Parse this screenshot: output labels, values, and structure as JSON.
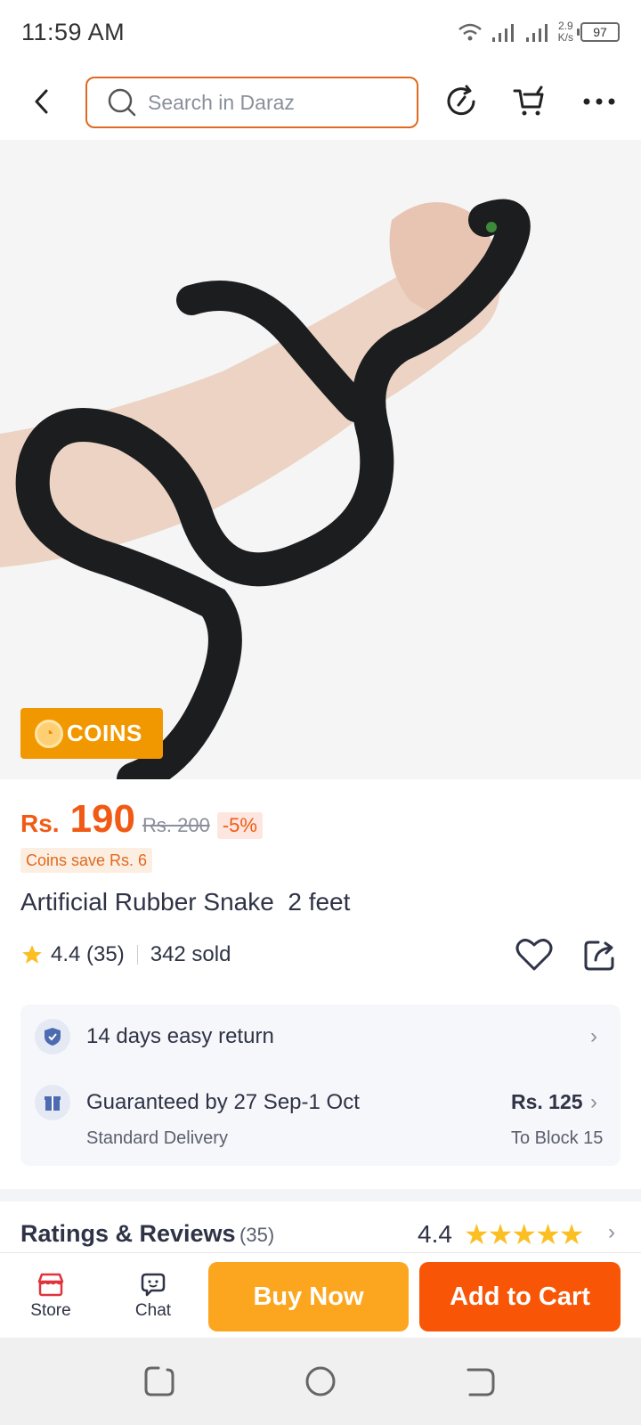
{
  "status_bar": {
    "time": "11:59 AM",
    "speed_value": "2.9",
    "speed_unit": "K/s",
    "battery": "97"
  },
  "header": {
    "search_placeholder": "Search in Daraz"
  },
  "product": {
    "coins_badge": "COINS",
    "currency": "Rs.",
    "price": "190",
    "old_price": "Rs. 200",
    "discount": "-5%",
    "coins_save": "Coins save Rs. 6",
    "title": "Artificial Rubber Snake  2 feet",
    "rating": "4.4 (35)",
    "sold": "342 sold"
  },
  "services": {
    "return_text": "14 days easy return",
    "delivery_text": "Guaranteed by 27 Sep-1 Oct",
    "delivery_type": "Standard Delivery",
    "delivery_fee": "Rs. 125",
    "delivery_to": "To Block 15"
  },
  "reviews": {
    "title": "Ratings & Reviews",
    "count": "(35)",
    "score": "4.4",
    "stars_value": 4.4,
    "stars_max": 5
  },
  "bottom_bar": {
    "store_label": "Store",
    "chat_label": "Chat",
    "buy_now_label": "Buy Now",
    "add_to_cart_label": "Add to Cart"
  },
  "colors": {
    "accent_orange": "#f85606",
    "buy_now": "#fca61f",
    "price": "#f05a14",
    "coins_badge": "#f19800",
    "star": "#fbbf24"
  },
  "icons": [
    "back-arrow-icon",
    "search-icon",
    "history-refresh-icon",
    "cart-icon",
    "more-dots-icon",
    "coin-icon",
    "star-icon",
    "heart-icon",
    "share-icon",
    "shield-check-icon",
    "gift-box-icon",
    "chevron-right-icon",
    "store-icon",
    "chat-icon"
  ]
}
